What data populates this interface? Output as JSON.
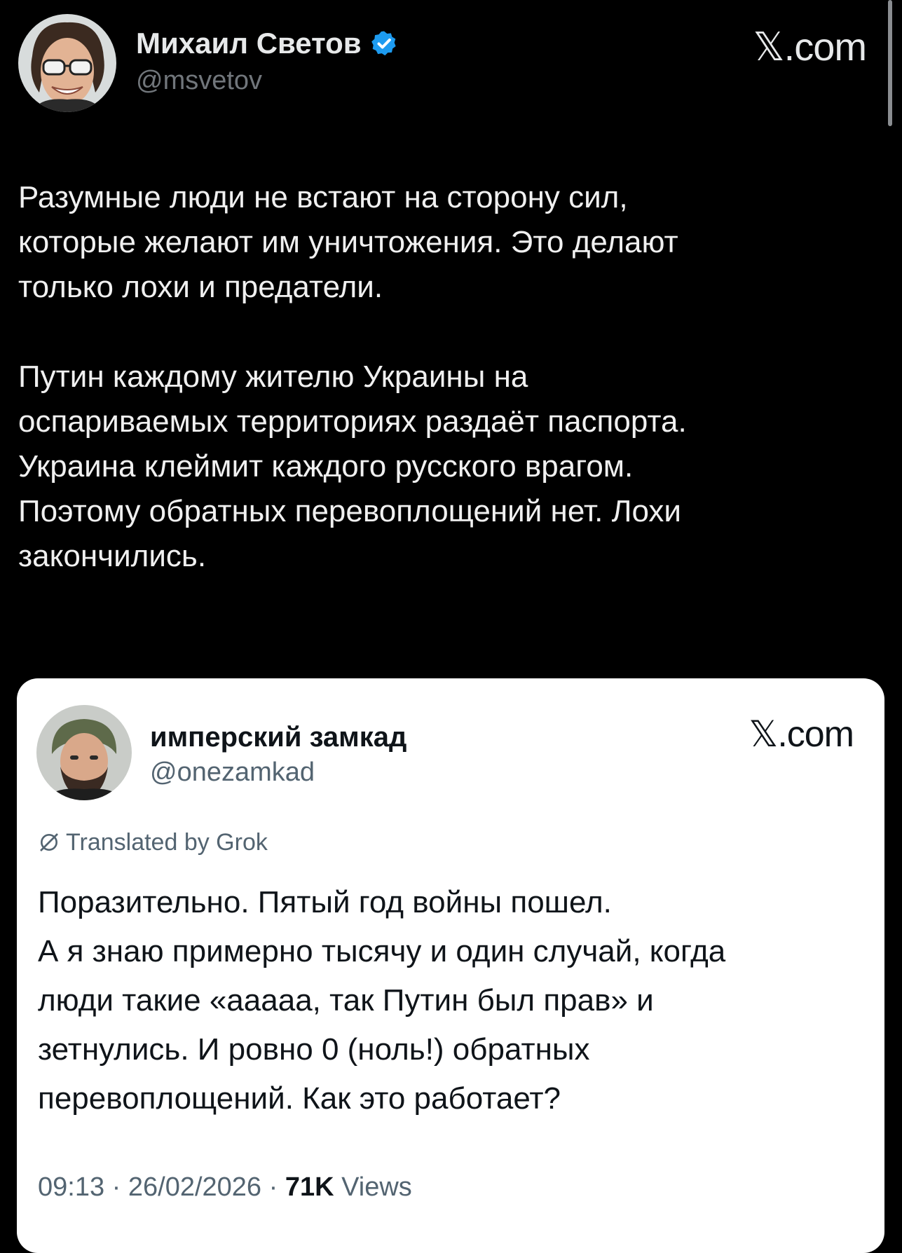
{
  "main_post": {
    "author_name": "Михаил Светов",
    "author_handle": "@msvetov",
    "verified": true,
    "site_label": "𝕏.com",
    "paragraphs": [
      "Разумные люди не встают на сторону сил,\nкоторые желают им уничтожения. Это делают\nтолько лохи и предатели.",
      "Путин каждому жителю Украины на\nоспариваемых территориях раздаёт паспорта.\nУкраина клеймит каждого русского врагом.\nПоэтому обратных перевоплощений нет. Лохи\nзакончились."
    ]
  },
  "quoted_post": {
    "author_name": "имперский замкад",
    "author_handle": "@onezamkad",
    "site_label": "𝕏.com",
    "translated_label": "Translated by Grok",
    "text": "Поразительно. Пятый год войны пошел.\nА я знаю примерно тысячу и один случай, когда\nлюди такие «ааааа, так Путин был прав» и\nзетнулись. И ровно 0 (ноль!) обратных\nперевоплощений. Как это работает?",
    "time": "09:13",
    "date": "26/02/2026",
    "views_count": "71K",
    "views_label": "Views"
  },
  "colors": {
    "background": "#000000",
    "verified_badge": "#1d9bf0",
    "card_background": "#ffffff",
    "secondary_text": "#71767b"
  }
}
